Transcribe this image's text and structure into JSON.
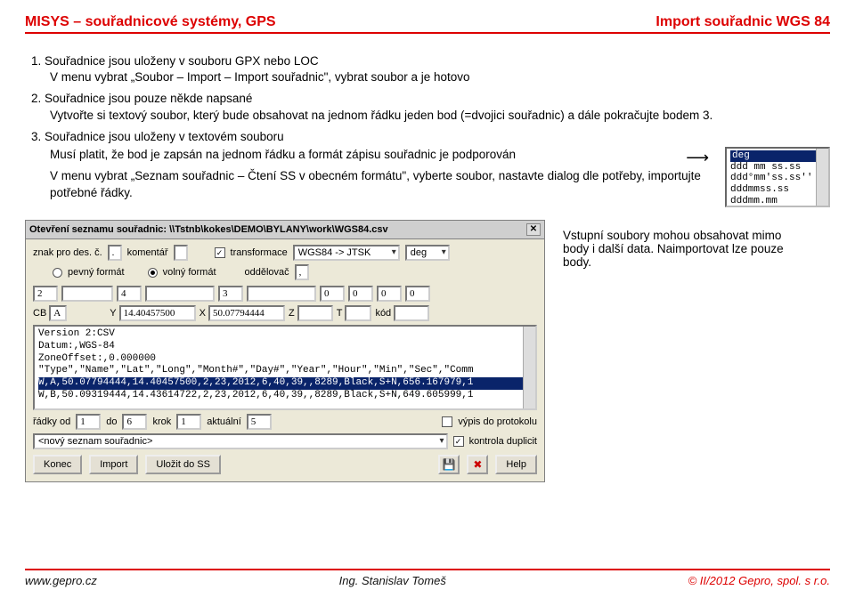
{
  "header": {
    "left": "MISYS – souřadnicové systémy, GPS",
    "right": "Import souřadnic WGS 84"
  },
  "list": {
    "item1_title": "Souřadnice jsou uloženy v souboru GPX nebo LOC",
    "item1_sub": "V menu vybrat „Soubor – Import – Import souřadnic\", vybrat soubor a je hotovo",
    "item2_title": "Souřadnice jsou pouze někde napsané",
    "item2_sub1": "Vytvořte si textový soubor, který bude obsahovat na jednom řádku jeden bod (=dvojici souřadnic) a dále pokračujte bodem 3.",
    "item3_title": "Souřadnice jsou uloženy v textovém souboru",
    "item3_sub1": "Musí platit, že bod je zapsán na jednom řádku a formát zápisu souřadnic je podporován",
    "item3_sub2": "V menu vybrat „Seznam souřadnic – Čtení SS v obecném formátu\", vyberte soubor, nastavte dialog dle potřeby, importujte potřebné řádky."
  },
  "degbox": {
    "l1": "deg",
    "l2": "ddd mm ss.ss",
    "l3": "ddd°mm'ss.ss''",
    "l4": "dddmmss.ss",
    "l5": "dddmm.mm"
  },
  "dialog": {
    "title": "Otevření seznamu souřadnic: \\\\Tstnb\\kokes\\DEMO\\BYLANY\\work\\WGS84.csv",
    "znak_label": "znak pro des. č.",
    "znak_val": ".",
    "koment_label": "komentář",
    "transform_label": "transformace",
    "transform_val": "WGS84 -> JTSK",
    "unit_val": "deg",
    "pevny": "pevný formát",
    "volny": "volný formát",
    "oddel": "oddělovač",
    "oddel_val": ",",
    "f2": "2",
    "f4": "4",
    "f3": "3",
    "f0a": "0",
    "f0b": "0",
    "f0c": "0",
    "f0d": "0",
    "CB": "CB",
    "A": "A",
    "Y": "Y",
    "yval": "14.40457500",
    "X": "X",
    "xval": "50.07794444",
    "Z": "Z",
    "T": "T",
    "kod": "kód",
    "line1": "Version 2:CSV",
    "line2": "Datum:,WGS-84",
    "line3": "ZoneOffset:,0.000000",
    "line4": "\"Type\",\"Name\",\"Lat\",\"Long\",\"Month#\",\"Day#\",\"Year\",\"Hour\",\"Min\",\"Sec\",\"Comm",
    "line5": "W,A,50.07794444,14.40457500,2,23,2012,6,40,39,,8289,Black,S+N,656.167979,1",
    "line6": "W,B,50.09319444,14.43614722,2,23,2012,6,40,39,,8289,Black,S+N,649.605999,1",
    "r_od_lbl": "řádky od",
    "r_od": "1",
    "r_do_lbl": "do",
    "r_do": "6",
    "krok_lbl": "krok",
    "krok": "1",
    "akt_lbl": "aktuální",
    "akt": "5",
    "vypis": "výpis do protokolu",
    "novy": "<nový seznam souřadnic>",
    "duplic": "kontrola duplicit",
    "btn_konec": "Konec",
    "btn_import": "Import",
    "btn_ulozit": "Uložit do SS",
    "btn_help": "Help"
  },
  "side": {
    "p1": "Vstupní soubory mohou obsahovat mimo body i další data. Naimportovat lze pouze body."
  },
  "footer": {
    "left": "www.gepro.cz",
    "mid": "Ing. Stanislav Tomeš",
    "right": "© II/2012 Gepro, spol. s r.o."
  }
}
